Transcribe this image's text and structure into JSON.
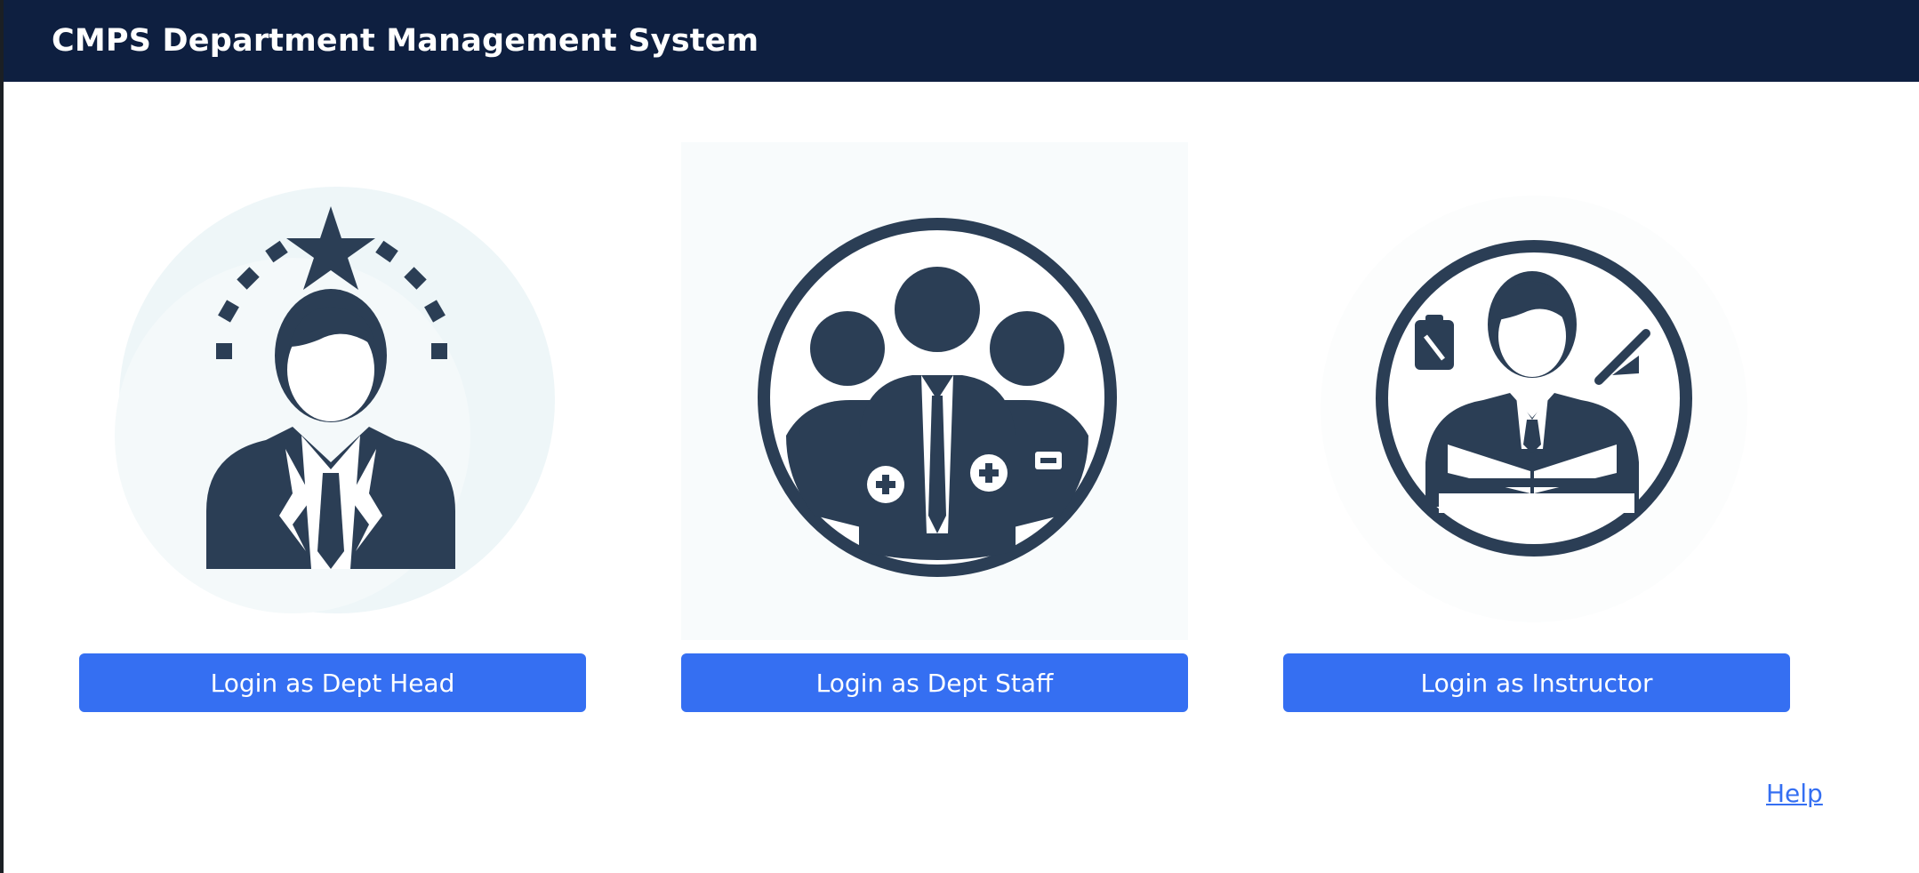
{
  "header": {
    "title": "CMPS Department Management System"
  },
  "roles": [
    {
      "label": "Login as Dept Head",
      "icon": "dept-head-icon"
    },
    {
      "label": "Login as Dept Staff",
      "icon": "dept-staff-icon"
    },
    {
      "label": "Login as Instructor",
      "icon": "instructor-icon"
    }
  ],
  "help": {
    "label": "Help"
  },
  "colors": {
    "header_bg": "#0e1f40",
    "button_bg": "#356ff2",
    "icon_color": "#2b3e55",
    "link_color": "#356ff2"
  }
}
